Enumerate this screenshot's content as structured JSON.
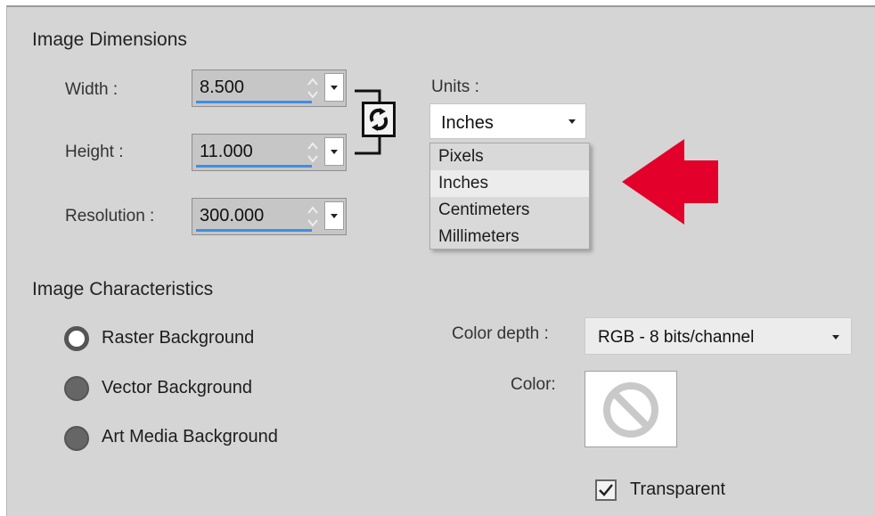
{
  "dimensions": {
    "title": "Image Dimensions",
    "width": {
      "label": "Width :",
      "value": "8.500"
    },
    "height": {
      "label": "Height :",
      "value": "11.000"
    },
    "resolution": {
      "label": "Resolution :",
      "value": "300.000"
    },
    "units": {
      "label": "Units :",
      "selected": "Inches",
      "options": [
        "Pixels",
        "Inches",
        "Centimeters",
        "Millimeters"
      ]
    }
  },
  "characteristics": {
    "title": "Image Characteristics",
    "backgrounds": [
      {
        "label": "Raster Background",
        "selected": true
      },
      {
        "label": "Vector Background",
        "selected": false
      },
      {
        "label": "Art Media Background",
        "selected": false
      }
    ],
    "color_depth": {
      "label": "Color depth :",
      "value": "RGB - 8 bits/channel"
    },
    "color": {
      "label": "Color:"
    },
    "transparent": {
      "label": "Transparent",
      "checked": true
    }
  },
  "colors": {
    "accent": "#3d8fe3",
    "arrow": "#e3002b"
  }
}
